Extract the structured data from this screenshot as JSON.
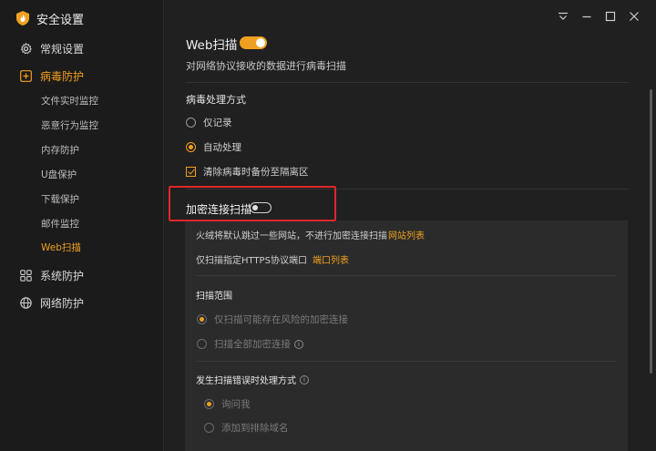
{
  "app": {
    "title": "安全设置"
  },
  "sidebar": {
    "items": [
      {
        "label": "常规设置",
        "icon": "gear-icon"
      },
      {
        "label": "病毒防护",
        "icon": "plus-square-icon"
      },
      {
        "label": "系统防护",
        "icon": "grid-icon"
      },
      {
        "label": "网络防护",
        "icon": "globe-icon"
      }
    ],
    "subitems": [
      "文件实时监控",
      "恶意行为监控",
      "内存防护",
      "U盘保护",
      "下载保护",
      "邮件监控",
      "Web扫描"
    ]
  },
  "main": {
    "web_scan": {
      "title": "Web扫描",
      "enabled": true,
      "description": "对网络协议接收的数据进行病毒扫描"
    },
    "virus_handling": {
      "title": "病毒处理方式",
      "options": [
        "仅记录",
        "自动处理"
      ],
      "selected": "自动处理",
      "backup_label": "清除病毒时备份至隔离区",
      "backup_checked": true
    },
    "encrypted_scan": {
      "label": "加密连接扫描",
      "enabled": false,
      "skip_text": "火绒将默认跳过一些网站，不进行加密连接扫描",
      "skip_link": "网站列表",
      "https_text": "仅扫描指定HTTPS协议端口",
      "https_link": "端口列表",
      "scope_title": "扫描范围",
      "scope_options": [
        "仅扫描可能存在风险的加密连接",
        "扫描全部加密连接"
      ],
      "error_title": "发生扫描错误时处理方式",
      "error_options": [
        "询问我",
        "添加到排除域名"
      ]
    }
  },
  "colors": {
    "accent": "#f0a020",
    "highlight": "#e0262b",
    "background": "#202020"
  }
}
